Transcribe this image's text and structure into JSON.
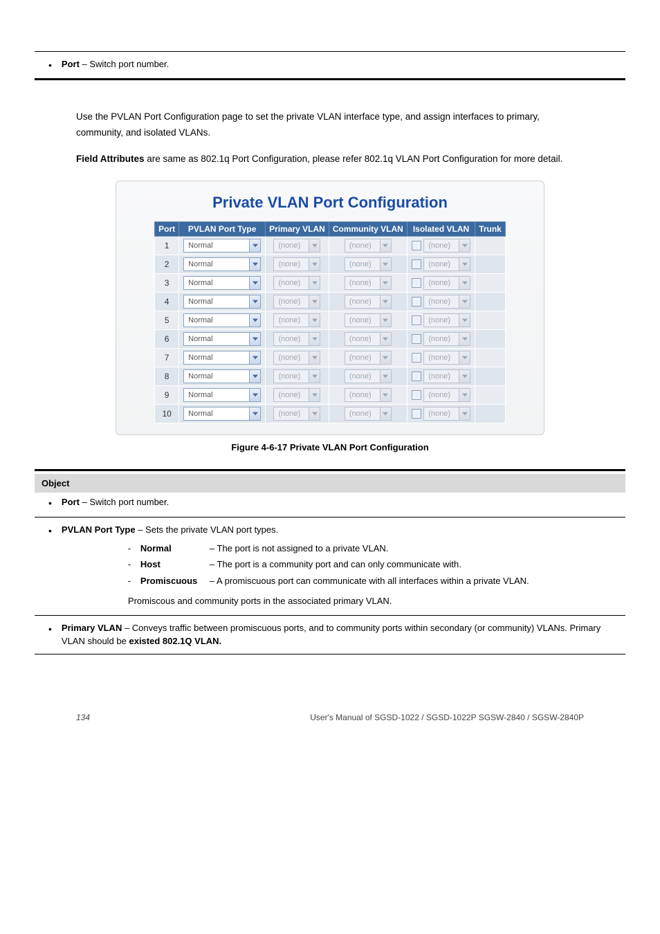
{
  "top_item": {
    "label": "Port",
    "desc": "– Switch port number."
  },
  "intro": {
    "p1": "Use the PVLAN Port Configuration page to set the private VLAN interface type, and assign interfaces to primary, community, and isolated VLANs.",
    "p2_prefix": "Field Attributes ",
    "p2_rest": "are same as 802.1q Port Configuration, please refer 802.1q VLAN Port Configuration for more detail."
  },
  "figure": {
    "title": "Private VLAN Port Configuration",
    "headers": [
      "Port",
      "PVLAN Port Type",
      "Primary VLAN",
      "Community VLAN",
      "Isolated VLAN",
      "Trunk"
    ],
    "port_type_value": "Normal",
    "none_value": "(none)",
    "rows": [
      1,
      2,
      3,
      4,
      5,
      6,
      7,
      8,
      9,
      10
    ]
  },
  "caption": "Figure 4-6-17 Private VLAN Port Configuration",
  "object_bar": "Object",
  "fields": {
    "port": {
      "label": "Port",
      "desc": "– Switch port number."
    },
    "pvlan": {
      "label": "PVLAN Port Type",
      "desc": "– Sets the private VLAN port types.",
      "items": [
        {
          "term": "Normal",
          "def": "– The port is not assigned to a private VLAN."
        },
        {
          "term": "Host",
          "def": "– The port is a community port and can only communicate with."
        },
        {
          "term": "Promiscuous",
          "def": "– A promiscuous port can communicate with all interfaces within a private VLAN."
        }
      ],
      "last": "Promiscous and community ports in the associated primary VLAN."
    },
    "primary": {
      "label": "Primary VLAN",
      "desc_a": "– Conveys traffic between promiscuous ports, and to community ports within secondary (or community) VLANs. Primary VLAN should be",
      "desc_b": " existed 802.1Q VLAN."
    }
  },
  "footer": {
    "page": "134",
    "manual": "User's Manual of SGSD-1022 / SGSD-1022P  SGSW-2840 / SGSW-2840P"
  }
}
